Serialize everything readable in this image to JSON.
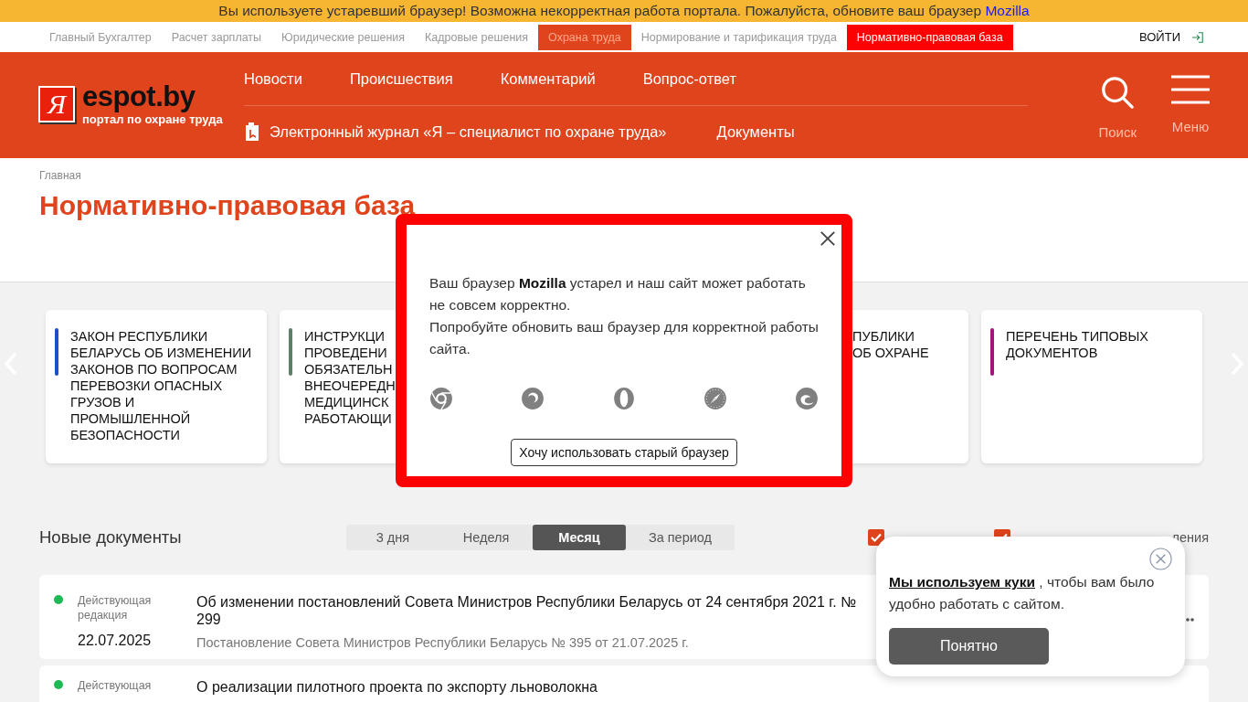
{
  "warning_bar": {
    "text": "Вы используете устаревший браузер! Возможна некорректная работа портала. Пожалуйста, обновите ваш браузер",
    "link": "Mozilla"
  },
  "top_nav": {
    "items": [
      {
        "label": "Главный Бухгалтер",
        "selected": false,
        "highlighted": false
      },
      {
        "label": "Расчет зарплаты",
        "selected": false,
        "highlighted": false
      },
      {
        "label": "Юридические решения",
        "selected": false,
        "highlighted": false
      },
      {
        "label": "Кадровые решения",
        "selected": false,
        "highlighted": false
      },
      {
        "label": "Охрана труда",
        "selected": true,
        "highlighted": false
      },
      {
        "label": "Нормирование и тарификация труда",
        "selected": false,
        "highlighted": false
      },
      {
        "label": "Нормативно-правовая база",
        "selected": false,
        "highlighted": true
      }
    ],
    "login": "ВОЙТИ"
  },
  "header": {
    "logo": {
      "mark": "Я",
      "name": "espot.by",
      "tagline": "портал по охране труда"
    },
    "nav_primary": [
      "Новости",
      "Происшествия",
      "Комментарий",
      "Вопрос-ответ"
    ],
    "nav_secondary": [
      {
        "kind": "journal",
        "label": "Электронный журнал «Я – специалист по охране труда»"
      },
      {
        "kind": "link",
        "label": "Документы"
      }
    ],
    "search_label": "Поиск",
    "menu_label": "Меню"
  },
  "breadcrumbs": [
    "Главная"
  ],
  "page_title": "Нормативно-правовая база",
  "featured_cards": [
    {
      "color": "#1f4fc8",
      "lines": [
        "ЗАКОН РЕСПУБЛИКИ",
        "БЕЛАРУСЬ ОБ ИЗМЕНЕНИИ",
        "ЗАКОНОВ ПО ВОПРОСАМ",
        "ПЕРЕВОЗКИ ОПАСНЫХ",
        "ГРУЗОВ И",
        "ПРОМЫШЛЕННОЙ",
        "БЕЗОПАСНОСТИ"
      ]
    },
    {
      "color": "#5f7f6a",
      "lines": [
        "ИНСТРУКЦИ",
        "ПРОВЕДЕНИ",
        "ОБЯЗАТЕЛЬН",
        "ВНЕОЧЕРЕДН",
        "МЕДИЦИНСК",
        "РАБОТАЮЩИ"
      ]
    },
    {
      "lines": [
        "ПУБЛИКИ",
        "ОБ ОХРАНЕ"
      ]
    },
    {
      "color": "#a3147f",
      "lines": [
        "ПЕРЕЧЕНЬ ТИПОВЫХ",
        "ДОКУМЕНТОВ"
      ]
    }
  ],
  "new_documents": {
    "title": "Новые документы",
    "periods": [
      {
        "label": "3 дня",
        "selected": false
      },
      {
        "label": "Неделя",
        "selected": false
      },
      {
        "label": "Месяц",
        "selected": true
      },
      {
        "label": "За период",
        "selected": false
      }
    ],
    "filters": [
      {
        "checked": true
      },
      {
        "checked": true
      }
    ],
    "filter_tail": "ления",
    "rows": [
      {
        "color": "#1db954",
        "status": "Действующая редакция",
        "date": "22.07.2025",
        "title": "Об изменении постановлений Совета Министров Республики Беларусь от 24 сентября 2021 г. № 299",
        "subtitle": "Постановление Совета Министров Республики Беларусь № 395 от 21.07.2025 г."
      },
      {
        "color": "#1db954",
        "status": "Действующая",
        "title": "О реализации пилотного проекта по экспорту льноволокна"
      }
    ]
  },
  "browser_modal": {
    "message": "Ваш браузер **Mozilla** устарел и наш сайт может работать не совсем корректно.",
    "message_2": "Попробуйте обновить ваш браузер для корректной работы сайта.",
    "browsers": [
      {
        "kind": "chrome"
      },
      {
        "kind": "firefox"
      },
      {
        "kind": "opera"
      },
      {
        "kind": "safari"
      },
      {
        "kind": "edge"
      }
    ],
    "button": "Хочу использовать старый браузер"
  },
  "cookie_popup": {
    "link": "Мы используем куки",
    "text": " , чтобы вам было удобно работать с сайтом.",
    "button": "Понятно"
  }
}
